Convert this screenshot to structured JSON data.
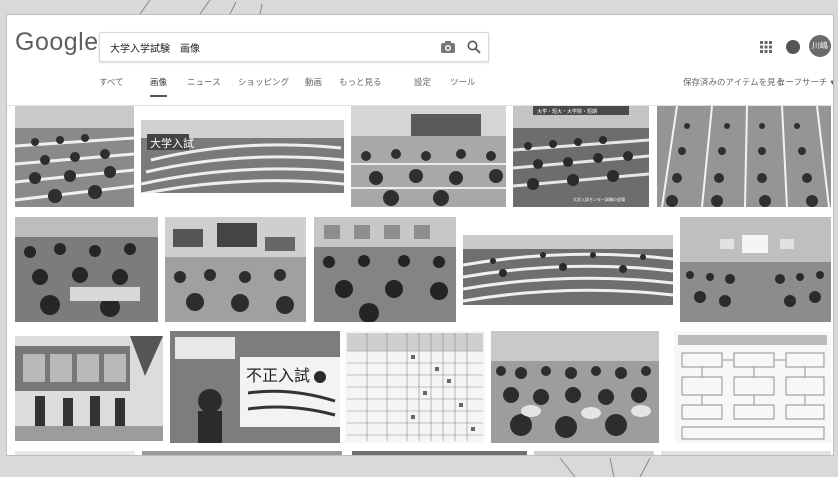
{
  "header": {
    "logo": "Google",
    "search": {
      "value": "大学入学試験　画像"
    },
    "avatar_initials": "川嶋"
  },
  "nav": {
    "tabs": [
      {
        "label": "すべて"
      },
      {
        "label": "画像",
        "active": true
      },
      {
        "label": "ニュース"
      },
      {
        "label": "ショッピング"
      },
      {
        "label": "動画"
      },
      {
        "label": "もっと見る"
      },
      {
        "label": "設定"
      },
      {
        "label": "ツール"
      }
    ],
    "saved_items": "保存済みのアイテムを見る",
    "safesearch": "セーフサーチ ▾"
  },
  "results": {
    "row1": [
      {
        "subject": "lecture hall exam"
      },
      {
        "subject": "lecture hall exam",
        "overlay_text": "大学入試"
      },
      {
        "subject": "classroom exam"
      },
      {
        "subject": "lecture hall exam",
        "overlay_text": "大学入試センター試験の会場",
        "caption_text": "大学・短大・大学院・短期"
      },
      {
        "subject": "exam hall rows"
      }
    ],
    "row2": [
      {
        "subject": "exam room"
      },
      {
        "subject": "lecture hall with screens"
      },
      {
        "subject": "exam room"
      },
      {
        "subject": "lecture hall"
      },
      {
        "subject": "lecture hall with projector"
      }
    ],
    "row3": [
      {
        "subject": "notice board outdoors"
      },
      {
        "subject": "protest banner",
        "banner_text": "不正入試"
      },
      {
        "subject": "results table"
      },
      {
        "subject": "exam crowd"
      },
      {
        "subject": "flow diagram"
      }
    ]
  },
  "colors": {
    "page_bg": "#ffffff",
    "text": "#5f5f5f",
    "tile_dark": "#3a3a3a",
    "tile_light": "#bcbcbc"
  }
}
